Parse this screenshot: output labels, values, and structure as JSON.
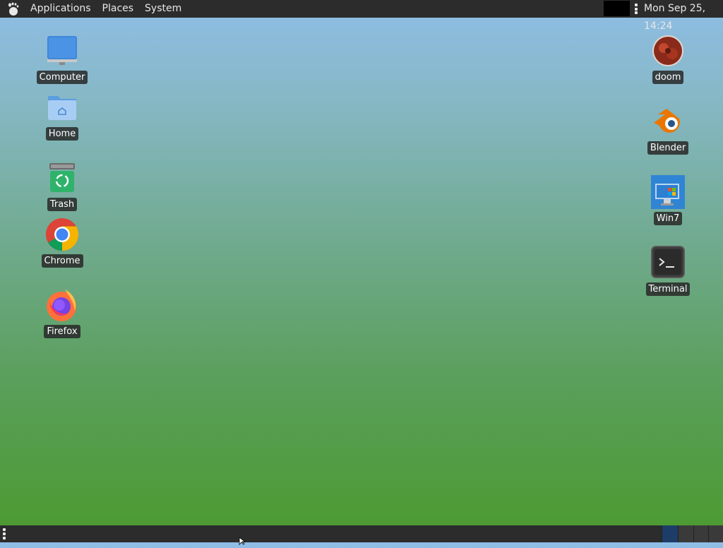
{
  "top_panel": {
    "menu": [
      "Applications",
      "Places",
      "System"
    ],
    "clock": "Mon Sep 25, 14:24"
  },
  "desktop_icons_left": [
    {
      "label": "Computer",
      "icon": "computer-icon"
    },
    {
      "label": "Home",
      "icon": "home-folder-icon"
    },
    {
      "label": "Trash",
      "icon": "trash-icon"
    },
    {
      "label": "Chrome",
      "icon": "chrome-icon"
    },
    {
      "label": "Firefox",
      "icon": "firefox-icon"
    }
  ],
  "desktop_icons_right": [
    {
      "label": "doom",
      "icon": "doom-icon"
    },
    {
      "label": "Blender",
      "icon": "blender-icon"
    },
    {
      "label": "Win7",
      "icon": "win7-icon"
    },
    {
      "label": "Terminal",
      "icon": "terminal-icon"
    }
  ],
  "colors": {
    "panel": "#2c2c2c",
    "desktop_top": "#8fbde6",
    "desktop_bottom": "#4b9a2f"
  }
}
